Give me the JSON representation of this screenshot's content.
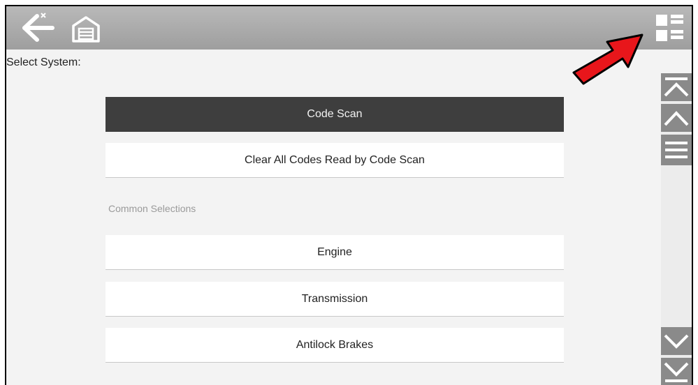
{
  "header": {
    "back_icon": "back-arrow-icon",
    "home_icon": "garage-home-icon",
    "view_icon": "grid-view-icon"
  },
  "page": {
    "select_label": "Select System:"
  },
  "menu": {
    "primary": [
      {
        "label": "Code Scan",
        "selected": true
      },
      {
        "label": "Clear All Codes Read by Code Scan",
        "selected": false
      }
    ],
    "section_label": "Common Selections",
    "common": [
      {
        "label": "Engine"
      },
      {
        "label": "Transmission"
      },
      {
        "label": "Antilock Brakes"
      }
    ]
  },
  "scrollbar": {
    "buttons": [
      "scroll-top-icon",
      "scroll-up-icon",
      "scroll-handle-icon",
      "scroll-down-icon",
      "scroll-bottom-icon"
    ]
  },
  "annotation": {
    "arrow_color": "#e8161b"
  },
  "colors": {
    "topbar": "#aaaaaa",
    "selected_row": "#3e3e3e",
    "background": "#f3f3f3"
  }
}
